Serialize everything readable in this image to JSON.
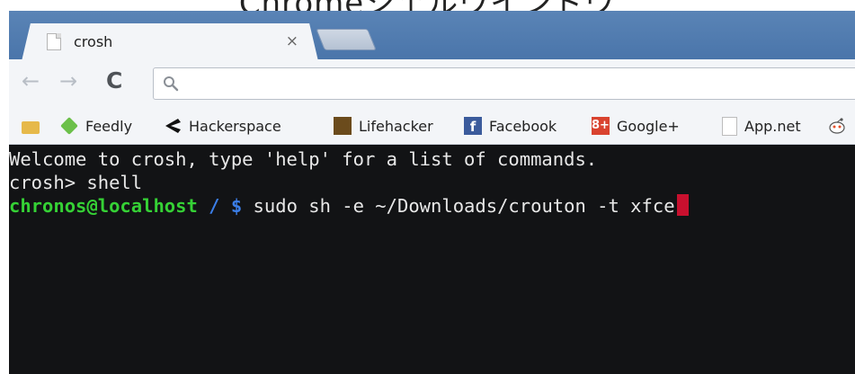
{
  "caption": "Chromeシェルウインドウ",
  "browser": {
    "tab": {
      "title": "crosh",
      "close": "×"
    },
    "toolbar": {
      "back": "←",
      "forward": "→",
      "reload": "C"
    },
    "bookmarks": [
      {
        "label": "",
        "icon": "folder-icon"
      },
      {
        "label": "Feedly",
        "icon": "feedly-icon"
      },
      {
        "label": "Hackerspace",
        "icon": "hackerspace-icon"
      },
      {
        "label": "Lifehacker",
        "icon": "lifehacker-icon"
      },
      {
        "label": "Facebook",
        "icon": "facebook-icon"
      },
      {
        "label": "Google+",
        "icon": "google-plus-icon"
      },
      {
        "label": "App.net",
        "icon": "page-icon"
      },
      {
        "label": "",
        "icon": "reddit-icon"
      }
    ]
  },
  "terminal": {
    "welcome": "Welcome to crosh, type 'help' for a list of commands.",
    "crosh_prompt": "crosh> shell",
    "user": "chronos@localhost",
    "path": " / $",
    "command": " sudo sh -e ~/Downloads/crouton -t xfce"
  },
  "colors": {
    "titlebar": "#4a75aa",
    "terminal_bg": "#121315",
    "prompt_user": "#35d135",
    "prompt_path": "#3b7ee8",
    "cursor": "#c8102e"
  }
}
